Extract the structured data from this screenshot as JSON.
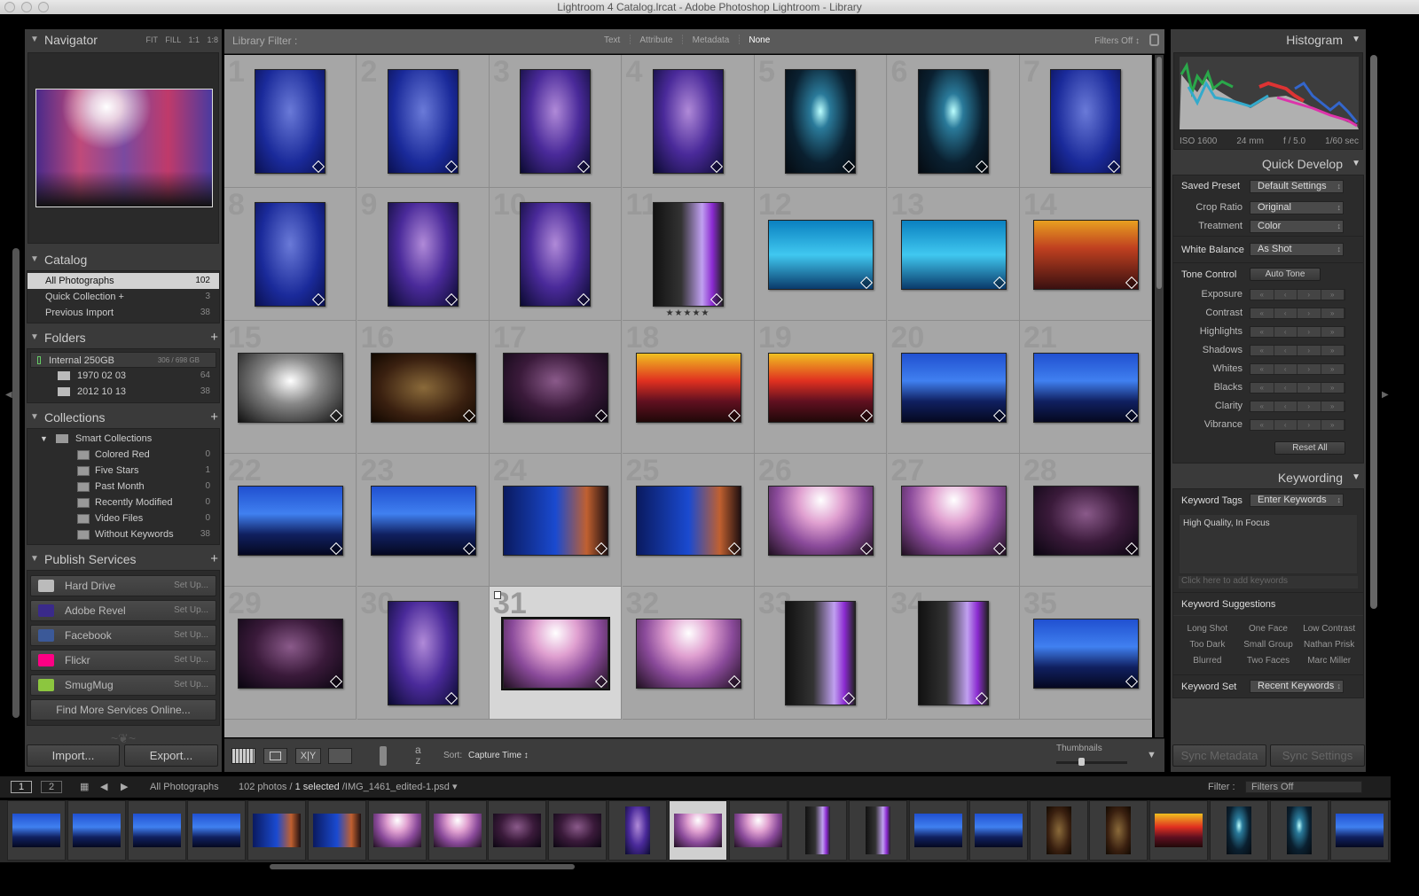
{
  "window": {
    "title": "Lightroom 4 Catalog.lrcat - Adobe Photoshop Lightroom - Library"
  },
  "navigator": {
    "title": "Navigator",
    "zoom_options": [
      "FIT",
      "FILL",
      "1:1",
      "1:8"
    ]
  },
  "catalog": {
    "title": "Catalog",
    "items": [
      {
        "label": "All Photographs",
        "count": "102",
        "selected": true
      },
      {
        "label": "Quick Collection +",
        "count": "3"
      },
      {
        "label": "Previous Import",
        "count": "38"
      }
    ]
  },
  "folders": {
    "title": "Folders",
    "volume": {
      "label": "Internal 250GB",
      "usage": "306 / 698 GB"
    },
    "items": [
      {
        "label": "1970 02 03",
        "count": "64"
      },
      {
        "label": "2012 10 13",
        "count": "38"
      }
    ]
  },
  "collections": {
    "title": "Collections",
    "group": "Smart Collections",
    "items": [
      {
        "label": "Colored Red",
        "count": "0"
      },
      {
        "label": "Five Stars",
        "count": "1"
      },
      {
        "label": "Past Month",
        "count": "0"
      },
      {
        "label": "Recently Modified",
        "count": "0"
      },
      {
        "label": "Video Files",
        "count": "0"
      },
      {
        "label": "Without Keywords",
        "count": "38"
      }
    ]
  },
  "publish": {
    "title": "Publish Services",
    "items": [
      {
        "label": "Hard Drive",
        "action": "Set Up...",
        "color": "#bbbbbb"
      },
      {
        "label": "Adobe Revel",
        "action": "Set Up...",
        "color": "#3a2a8a"
      },
      {
        "label": "Facebook",
        "action": "Set Up...",
        "color": "#3b5998"
      },
      {
        "label": "Flickr",
        "action": "Set Up...",
        "color": "#ff0084"
      },
      {
        "label": "SmugMug",
        "action": "Set Up...",
        "color": "#8cc63f"
      }
    ],
    "find_more": "Find More Services Online..."
  },
  "left_buttons": {
    "import": "Import...",
    "export": "Export..."
  },
  "filter_bar": {
    "label": "Library Filter :",
    "tabs": [
      "Text",
      "Attribute",
      "Metadata",
      "None"
    ],
    "active": "None",
    "preset": "Filters Off"
  },
  "grid": {
    "cells": [
      {
        "n": "1",
        "o": "p",
        "t": "blue"
      },
      {
        "n": "2",
        "o": "p",
        "t": "blue"
      },
      {
        "n": "3",
        "o": "p",
        "t": "purple"
      },
      {
        "n": "4",
        "o": "p",
        "t": "purple"
      },
      {
        "n": "5",
        "o": "p",
        "t": "darkcyan"
      },
      {
        "n": "6",
        "o": "p",
        "t": "darkcyan"
      },
      {
        "n": "7",
        "o": "p",
        "t": "blue"
      },
      {
        "n": "8",
        "o": "p",
        "t": "blue"
      },
      {
        "n": "9",
        "o": "p",
        "t": "purple"
      },
      {
        "n": "10",
        "o": "p",
        "t": "purple"
      },
      {
        "n": "11",
        "o": "p",
        "t": "violet",
        "stars": "★★★★★"
      },
      {
        "n": "12",
        "o": "l",
        "t": "cyan"
      },
      {
        "n": "13",
        "o": "l",
        "t": "cyan"
      },
      {
        "n": "14",
        "o": "l",
        "t": "orange"
      },
      {
        "n": "15",
        "o": "l",
        "t": "bw"
      },
      {
        "n": "16",
        "o": "l",
        "t": "brown"
      },
      {
        "n": "17",
        "o": "l",
        "t": "darkpurple"
      },
      {
        "n": "18",
        "o": "l",
        "t": "red"
      },
      {
        "n": "19",
        "o": "l",
        "t": "red"
      },
      {
        "n": "20",
        "o": "l",
        "t": "stageblue"
      },
      {
        "n": "21",
        "o": "l",
        "t": "stageblue"
      },
      {
        "n": "22",
        "o": "l",
        "t": "stageblue"
      },
      {
        "n": "23",
        "o": "l",
        "t": "stageblue"
      },
      {
        "n": "24",
        "o": "l",
        "t": "harp"
      },
      {
        "n": "25",
        "o": "l",
        "t": "harp"
      },
      {
        "n": "26",
        "o": "l",
        "t": "pink"
      },
      {
        "n": "27",
        "o": "l",
        "t": "pink"
      },
      {
        "n": "28",
        "o": "l",
        "t": "darkpurple"
      },
      {
        "n": "29",
        "o": "l",
        "t": "darkpurple"
      },
      {
        "n": "30",
        "o": "p",
        "t": "purple"
      },
      {
        "n": "31",
        "o": "l",
        "t": "pink",
        "selected": true
      },
      {
        "n": "32",
        "o": "l",
        "t": "pink"
      },
      {
        "n": "33",
        "o": "p",
        "t": "violet"
      },
      {
        "n": "34",
        "o": "p",
        "t": "violet"
      },
      {
        "n": "35",
        "o": "l",
        "t": "stageblue"
      }
    ]
  },
  "toolbar": {
    "sort_label": "Sort:",
    "sort_value": "Capture Time",
    "thumbnails_label": "Thumbnails",
    "thumbnail_size": 0.35
  },
  "histogram": {
    "title": "Histogram",
    "iso": "ISO 1600",
    "focal": "24 mm",
    "aperture": "f / 5.0",
    "shutter": "1/60 sec"
  },
  "quick_develop": {
    "title": "Quick Develop",
    "saved_preset": {
      "label": "Saved Preset",
      "value": "Default Settings"
    },
    "crop_ratio": {
      "label": "Crop Ratio",
      "value": "Original"
    },
    "treatment": {
      "label": "Treatment",
      "value": "Color"
    },
    "white_balance": {
      "label": "White Balance",
      "value": "As Shot"
    },
    "tone_control": {
      "label": "Tone Control",
      "button": "Auto Tone"
    },
    "sliders": [
      "Exposure",
      "Contrast",
      "Highlights",
      "Shadows",
      "Whites",
      "Blacks",
      "Clarity",
      "Vibrance"
    ],
    "reset": "Reset All"
  },
  "keywording": {
    "title": "Keywording",
    "tags_label": "Keyword Tags",
    "tags_mode": "Enter Keywords",
    "keywords": "High Quality, In Focus",
    "add_placeholder": "Click here to add keywords",
    "suggestions_label": "Keyword Suggestions",
    "suggestions": [
      "Long Shot",
      "One Face",
      "Low Contrast",
      "Too Dark",
      "Small Group",
      "Nathan Prisk",
      "Blurred",
      "Two Faces",
      "Marc Miller"
    ],
    "set_label": "Keyword Set",
    "set_value": "Recent Keywords"
  },
  "sync": {
    "metadata": "Sync Metadata",
    "settings": "Sync Settings"
  },
  "filmstrip": {
    "pages": [
      "1",
      "2"
    ],
    "source": "All Photographs",
    "count": "102 photos /",
    "selected": "1 selected",
    "file": "/IMG_1461_edited-1.psd",
    "filter_label": "Filter :",
    "filter_value": "Filters Off",
    "thumbs": [
      {
        "o": "l",
        "t": "stageblue"
      },
      {
        "o": "l",
        "t": "stageblue"
      },
      {
        "o": "l",
        "t": "stageblue"
      },
      {
        "o": "l",
        "t": "stageblue"
      },
      {
        "o": "l",
        "t": "harp"
      },
      {
        "o": "l",
        "t": "harp"
      },
      {
        "o": "l",
        "t": "pink"
      },
      {
        "o": "l",
        "t": "pink"
      },
      {
        "o": "l",
        "t": "darkpurple"
      },
      {
        "o": "l",
        "t": "darkpurple"
      },
      {
        "o": "p",
        "t": "purple"
      },
      {
        "o": "l",
        "t": "pink",
        "selected": true
      },
      {
        "o": "l",
        "t": "pink"
      },
      {
        "o": "p",
        "t": "violet"
      },
      {
        "o": "p",
        "t": "violet"
      },
      {
        "o": "l",
        "t": "stageblue"
      },
      {
        "o": "l",
        "t": "stageblue"
      },
      {
        "o": "p",
        "t": "brown"
      },
      {
        "o": "p",
        "t": "brown"
      },
      {
        "o": "l",
        "t": "red"
      },
      {
        "o": "p",
        "t": "darkcyan"
      },
      {
        "o": "p",
        "t": "darkcyan"
      },
      {
        "o": "l",
        "t": "stageblue"
      }
    ]
  }
}
